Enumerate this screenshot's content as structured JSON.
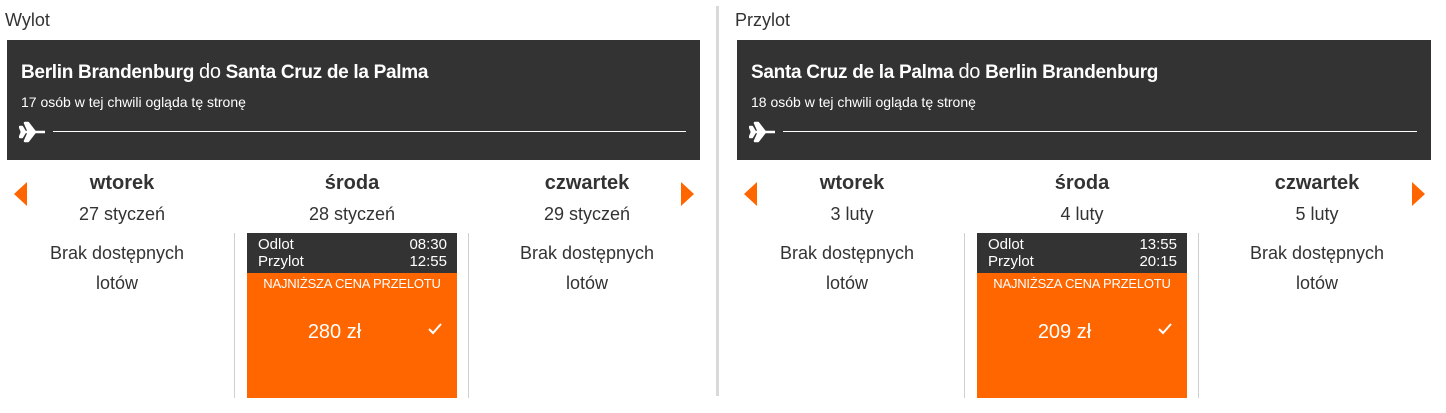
{
  "colors": {
    "accent": "#ff6600",
    "header_bg": "#333333",
    "text": "#333333"
  },
  "outbound": {
    "section_title": "Wylot",
    "route_from": "Berlin Brandenburg",
    "route_do": "do",
    "route_to": "Santa Cruz de la Palma",
    "viewers": "17 osób w tej chwili ogląda tę stronę",
    "icons": {
      "plane": "plane-icon",
      "prev": "triangle-left-icon",
      "next": "triangle-right-icon",
      "check": "check-icon"
    },
    "days": [
      {
        "dow": "wtorek",
        "date": "27 styczeń",
        "unavailable_line1": "Brak dostępnych",
        "unavailable_line2": "lotów"
      },
      {
        "dow": "środa",
        "date": "28 styczeń",
        "depart_label": "Odlot",
        "depart_time": "08:30",
        "arrive_label": "Przylot",
        "arrive_time": "12:55",
        "lowest_label": "NAJNIŻSZA CENA PRZELOTU",
        "price": "280 zł"
      },
      {
        "dow": "czwartek",
        "date": "29 styczeń",
        "unavailable_line1": "Brak dostępnych",
        "unavailable_line2": "lotów"
      }
    ]
  },
  "inbound": {
    "section_title": "Przylot",
    "route_from": "Santa Cruz de la Palma",
    "route_do": "do",
    "route_to": "Berlin Brandenburg",
    "viewers": "18 osób w tej chwili ogląda tę stronę",
    "days": [
      {
        "dow": "wtorek",
        "date": "3 luty",
        "unavailable_line1": "Brak dostępnych",
        "unavailable_line2": "lotów"
      },
      {
        "dow": "środa",
        "date": "4 luty",
        "depart_label": "Odlot",
        "depart_time": "13:55",
        "arrive_label": "Przylot",
        "arrive_time": "20:15",
        "lowest_label": "NAJNIŻSZA CENA PRZELOTU",
        "price": "209 zł"
      },
      {
        "dow": "czwartek",
        "date": "5 luty",
        "unavailable_line1": "Brak dostępnych",
        "unavailable_line2": "lotów"
      }
    ]
  }
}
